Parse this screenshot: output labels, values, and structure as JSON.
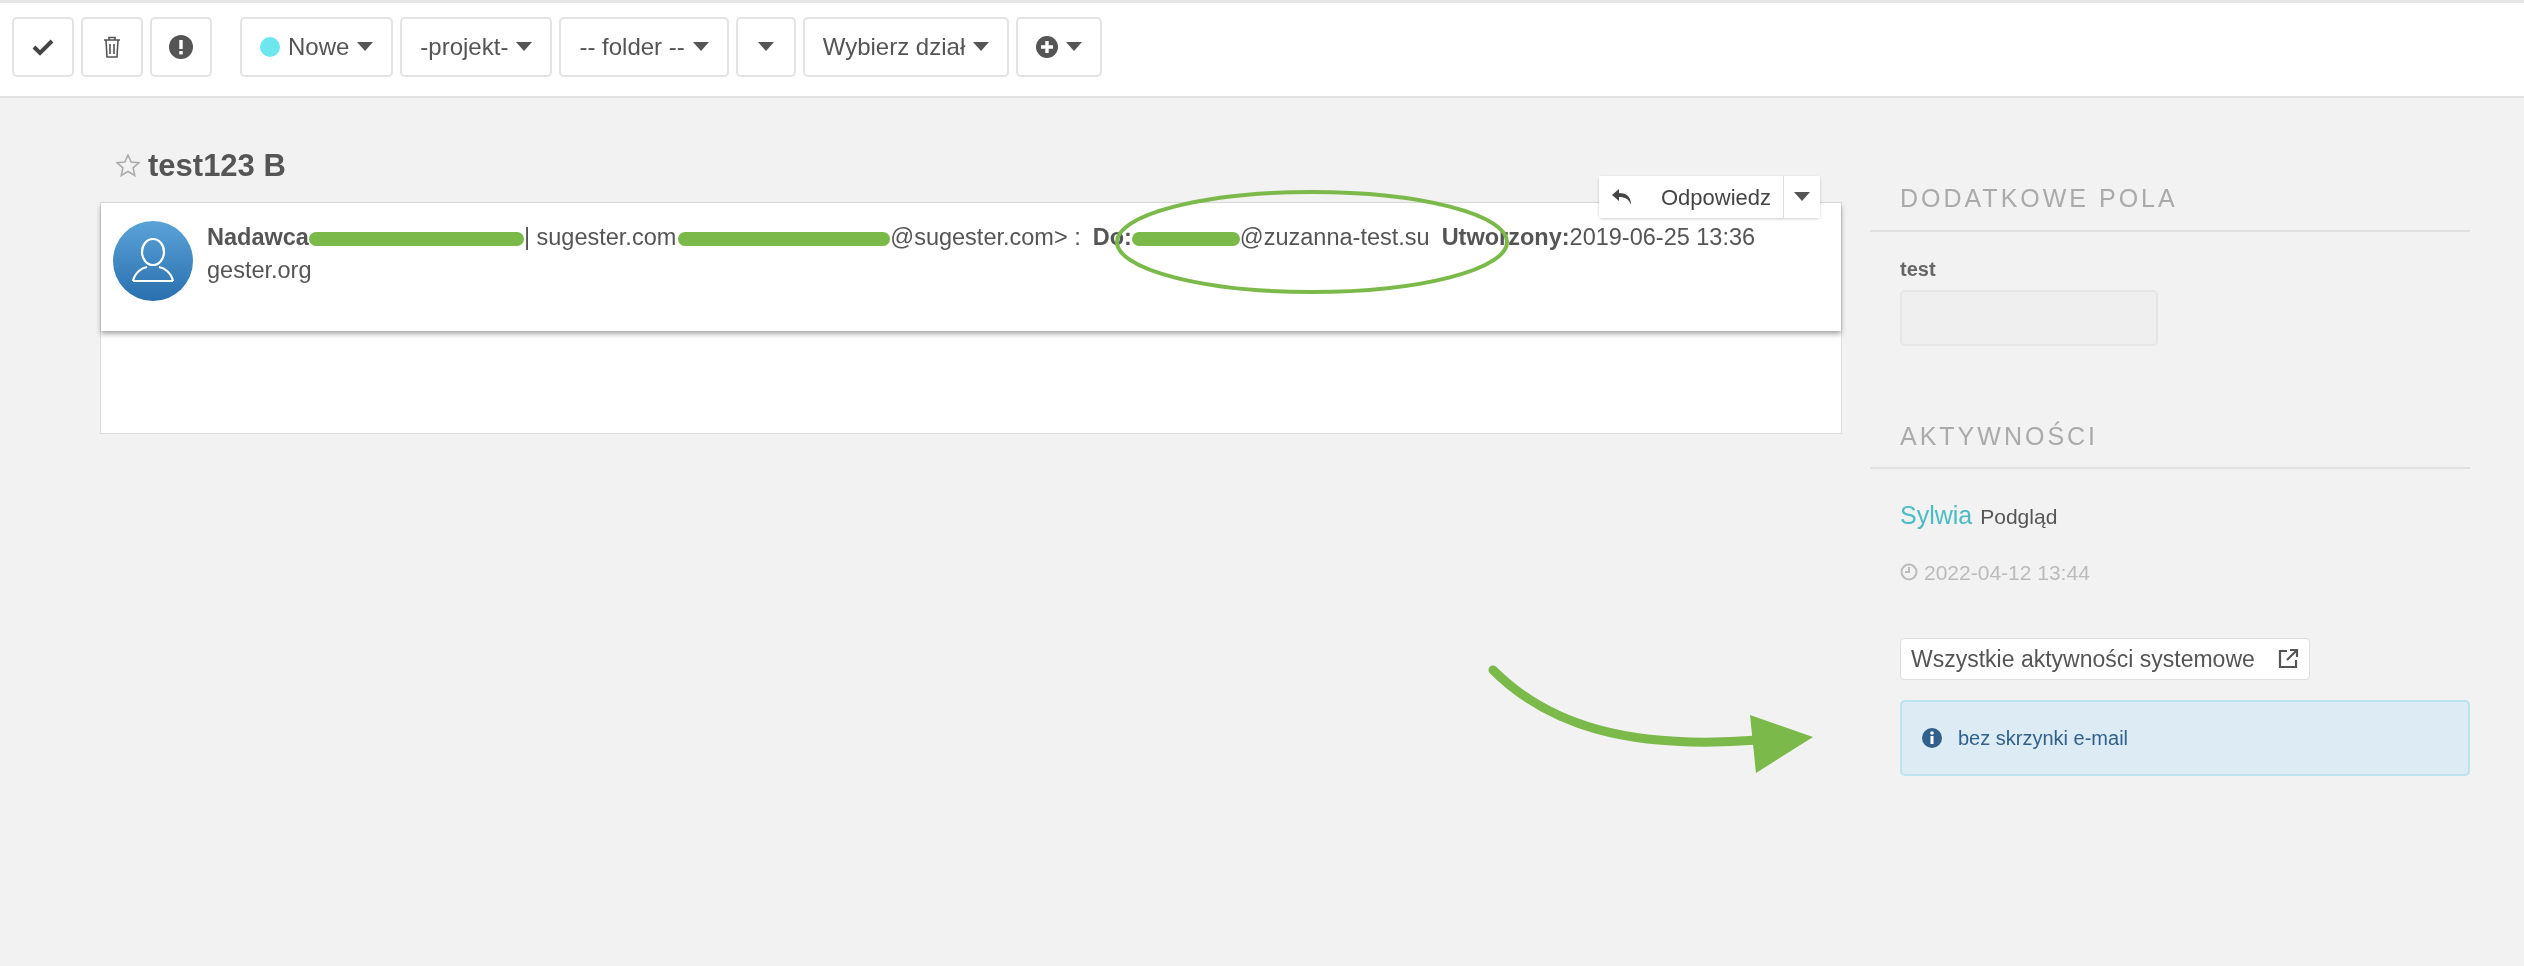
{
  "toolbar": {
    "groups": [
      [
        {
          "kind": "check"
        },
        {
          "kind": "trash"
        },
        {
          "kind": "alert"
        }
      ],
      [
        {
          "kind": "status",
          "label": "Nowe",
          "color": "#6ee6ee"
        },
        {
          "kind": "dropdown",
          "label": "-projekt-"
        },
        {
          "kind": "dropdown",
          "label": "-- folder --"
        },
        {
          "kind": "dropdown"
        },
        {
          "kind": "dropdown",
          "label": "Wybierz dział"
        },
        {
          "kind": "add"
        }
      ]
    ]
  },
  "message": {
    "title": "test123 B",
    "starred": false,
    "reply": {
      "label": "Odpowiedz"
    },
    "lines": [
      [
        {
          "kind": "label",
          "text": "Nadawca"
        },
        {
          "kind": "redacted"
        },
        {
          "kind": "text",
          "text": "| sugester.com"
        },
        {
          "kind": "redacted"
        },
        {
          "kind": "text",
          "text": "@sugester.com> :"
        },
        {
          "kind": "label",
          "text": "Do:"
        },
        {
          "kind": "redacted"
        },
        {
          "kind": "text",
          "text": "@zuzanna-test.su"
        },
        {
          "kind": "label",
          "text": "Utworzony:"
        },
        {
          "kind": "text",
          "text": "2019-06-25 13:36"
        }
      ],
      [
        {
          "kind": "text",
          "text": "gester.org"
        }
      ]
    ]
  },
  "sidebar": {
    "extra_fields": {
      "heading": "DODATKOWE POLA",
      "fields": [
        {
          "label": "test"
        }
      ]
    },
    "activities": {
      "heading": "AKTYWNOŚCI",
      "items": [
        {
          "user": "Sylwia",
          "action": "Podgląd",
          "time": "2022-04-12 13:44"
        }
      ]
    },
    "all_button": "Wszystkie aktywności systemowe",
    "alert": "bez skrzynki e-mail"
  },
  "annotations": {
    "ellipse": true,
    "arrow": true
  }
}
